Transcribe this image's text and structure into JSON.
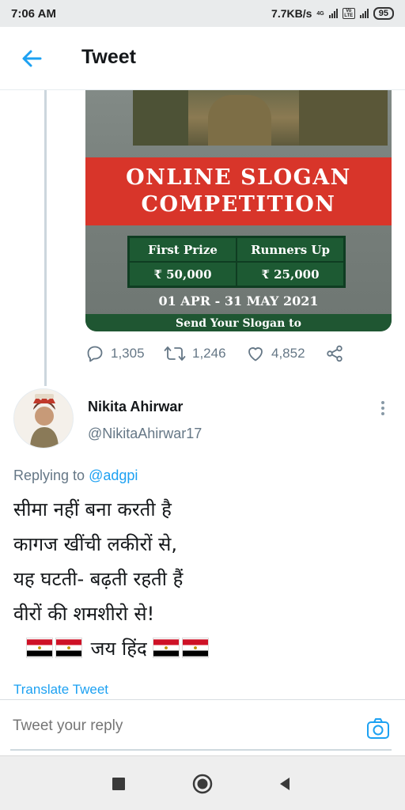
{
  "status_bar": {
    "time": "7:06 AM",
    "speed": "7.7KB/s",
    "net_type": "4G",
    "volte": "Vo LTE",
    "battery": "95"
  },
  "header": {
    "title": "Tweet",
    "back_icon": "arrow-left-icon"
  },
  "poster": {
    "banner_line1": "ONLINE SLOGAN",
    "banner_line2": "COMPETITION",
    "prize_headers": [
      "First Prize",
      "Runners Up"
    ],
    "prize_values": [
      "₹ 50,000",
      "₹ 25,000"
    ],
    "dates": "01 APR - 31 MAY 2021",
    "footer": "Send Your Slogan to"
  },
  "actions": {
    "reply_count": "1,305",
    "retweet_count": "1,246",
    "like_count": "4,852",
    "icons": [
      "reply-icon",
      "retweet-icon",
      "heart-icon",
      "share-icon"
    ]
  },
  "reply_tweet": {
    "name": "Nikita Ahirwar",
    "handle": "@NikitaAhirwar17",
    "replying_prefix": "Replying to",
    "replying_to": "@adgpi",
    "lines": [
      "सीमा नहीं बना करती है",
      "कागज खींची लकीरों से,",
      "यह घटती- बढ़ती रहती हैं",
      "वीरों की शमशीरो से!"
    ],
    "closing": "जय हिंद",
    "flag_emoji": "🇪🇬",
    "translate": "Translate Tweet"
  },
  "reply_bar": {
    "placeholder": "Tweet your reply",
    "camera_icon": "camera-icon"
  },
  "nav": {
    "icons": [
      "recent-apps-icon",
      "home-icon",
      "back-icon"
    ]
  },
  "colors": {
    "accent": "#1da1f2",
    "muted": "#657786",
    "banner_red": "#d8352a",
    "poster_green": "#1d5a33"
  }
}
